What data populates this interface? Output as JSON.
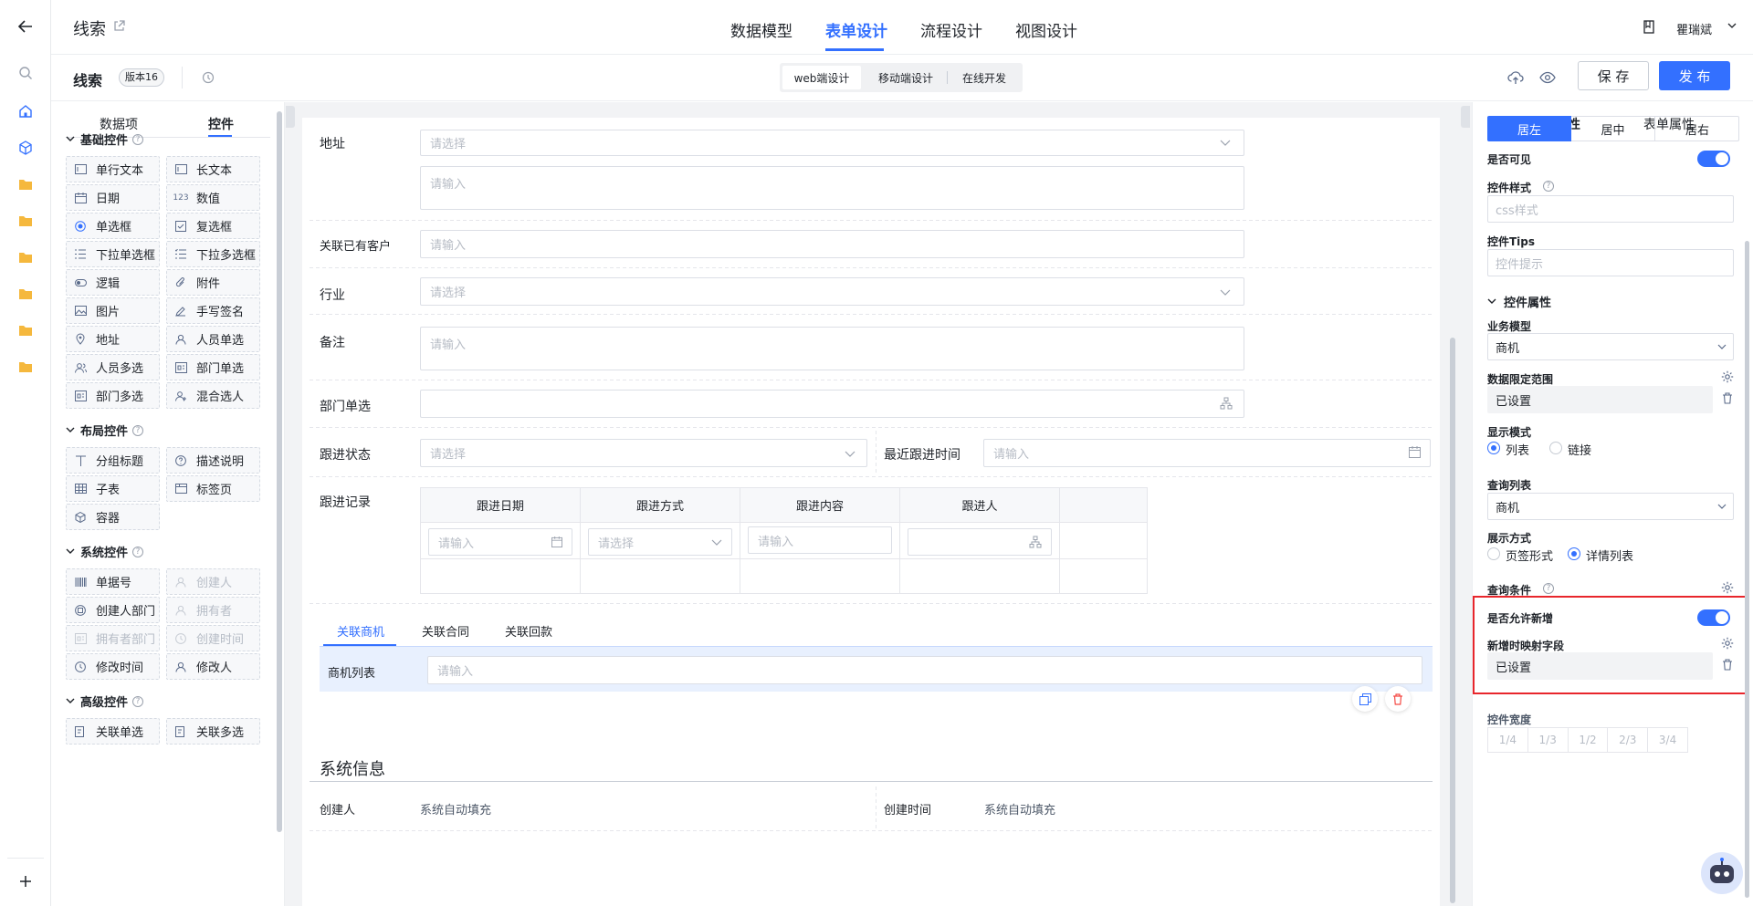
{
  "top": {
    "app_title": "线索",
    "tabs": [
      "数据模型",
      "表单设计",
      "流程设计",
      "视图设计"
    ],
    "active_tab": "表单设计",
    "user_name": "瞿瑞斌"
  },
  "toolbar": {
    "form_name": "线索",
    "version": "版本16",
    "modes": [
      "web端设计",
      "移动端设计",
      "在线开发"
    ],
    "save_label": "保 存",
    "publish_label": "发 布"
  },
  "left": {
    "tabs": [
      "数据项",
      "控件"
    ],
    "groups": [
      {
        "title": "基础控件",
        "items": [
          "单行文本",
          "长文本",
          "日期",
          "数值",
          "单选框",
          "复选框",
          "下拉单选框",
          "下拉多选框",
          "逻辑",
          "附件",
          "图片",
          "手写签名",
          "地址",
          "人员单选",
          "人员多选",
          "部门单选",
          "部门多选",
          "混合选人"
        ]
      },
      {
        "title": "布局控件",
        "items": [
          "分组标题",
          "描述说明",
          "子表",
          "标签页",
          "容器"
        ]
      },
      {
        "title": "系统控件",
        "items": [
          "单据号",
          "创建人",
          "创建人部门",
          "拥有者",
          "拥有者部门",
          "创建时间",
          "修改时间",
          "修改人"
        ]
      },
      {
        "title": "高级控件",
        "items": [
          "关联单选",
          "关联多选"
        ]
      }
    ]
  },
  "form": {
    "address_label": "地址",
    "address_select_ph": "请选择",
    "address_detail_ph": "请输入",
    "customer_label": "关联已有客户",
    "customer_ph": "请输入",
    "industry_label": "行业",
    "industry_ph": "请选择",
    "remark_label": "备注",
    "remark_ph": "请输入",
    "dept_label": "部门单选",
    "status_label": "跟进状态",
    "status_ph": "请选择",
    "last_follow_label": "最近跟进时间",
    "last_follow_ph": "请输入",
    "records_label": "跟进记录",
    "records_columns": [
      "跟进日期",
      "跟进方式",
      "跟进内容",
      "跟进人"
    ],
    "records_row_ph": [
      "请输入",
      "请选择",
      "请输入"
    ],
    "relation_tabs": [
      "关联商机",
      "关联合同",
      "关联回款"
    ],
    "opportunity_list_label": "商机列表",
    "opportunity_list_ph": "请输入",
    "system_section_title": "系统信息",
    "creator_label": "创建人",
    "creator_value": "系统自动填充",
    "created_time_label": "创建时间",
    "created_time_value": "系统自动填充"
  },
  "right": {
    "tabs": [
      "控件属性",
      "表单属性"
    ],
    "align_options": [
      "居左",
      "居中",
      "居右"
    ],
    "visible_label": "是否可见",
    "style_label": "控件样式",
    "style_ph": "css样式",
    "tips_label": "控件Tips",
    "tips_ph": "控件提示",
    "props_section": "控件属性",
    "biz_model_label": "业务模型",
    "biz_model_value": "商机",
    "data_scope_label": "数据限定范围",
    "data_scope_value": "已设置",
    "display_mode_label": "显示模式",
    "display_mode_options": [
      "列表",
      "链接"
    ],
    "query_list_label": "查询列表",
    "query_list_value": "商机",
    "show_mode_label": "展示方式",
    "show_mode_options": [
      "页签形式",
      "详情列表"
    ],
    "query_cond_label": "查询条件",
    "allow_add_label": "是否允许新增",
    "mapping_label": "新增时映射字段",
    "mapping_value": "已设置",
    "width_label": "控件宽度",
    "width_options": [
      "1/4",
      "1/3",
      "1/2",
      "2/3",
      "3/4"
    ]
  },
  "colors": {
    "accent": "#3370ff",
    "highlight_border": "#e8262c",
    "danger": "#f54a45"
  }
}
